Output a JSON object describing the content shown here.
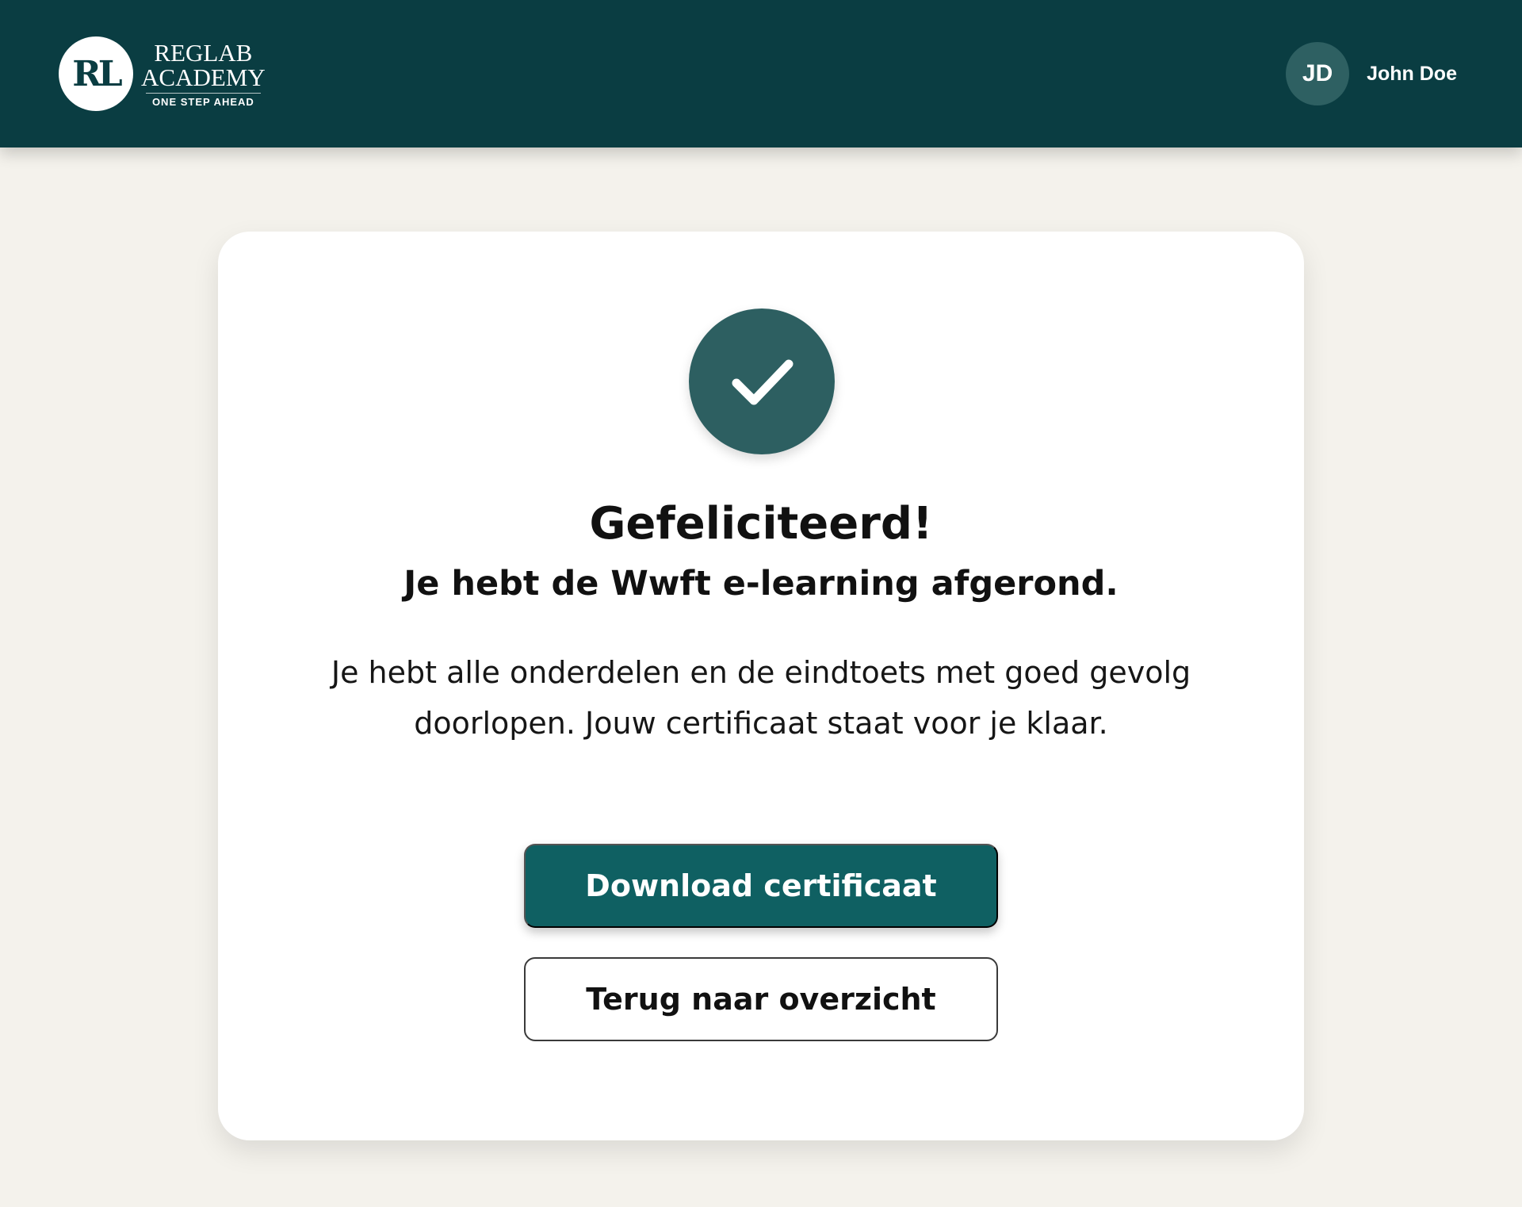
{
  "header": {
    "logo": {
      "mark": "RL",
      "name_line1": "REGLAB",
      "name_line2": "ACADEMY",
      "tagline": "ONE STEP AHEAD"
    },
    "user": {
      "initials": "JD",
      "name": "John Doe"
    }
  },
  "completion": {
    "icon": "checkmark-icon",
    "title": "Gefeliciteerd!",
    "subtitle": "Je hebt de Wwft e-learning afgerond.",
    "description": "Je hebt alle onderdelen en de eindtoets met goed gevolg doorlopen. Jouw certificaat staat voor je klaar.",
    "primary_button": "Download certificaat",
    "secondary_button": "Terug naar overzicht"
  },
  "colors": {
    "header_bg": "#0a3d42",
    "page_bg": "#f4f2ec",
    "accent": "#0f6062",
    "check_circle": "#2d5f61",
    "avatar_bg": "#2e6062"
  }
}
